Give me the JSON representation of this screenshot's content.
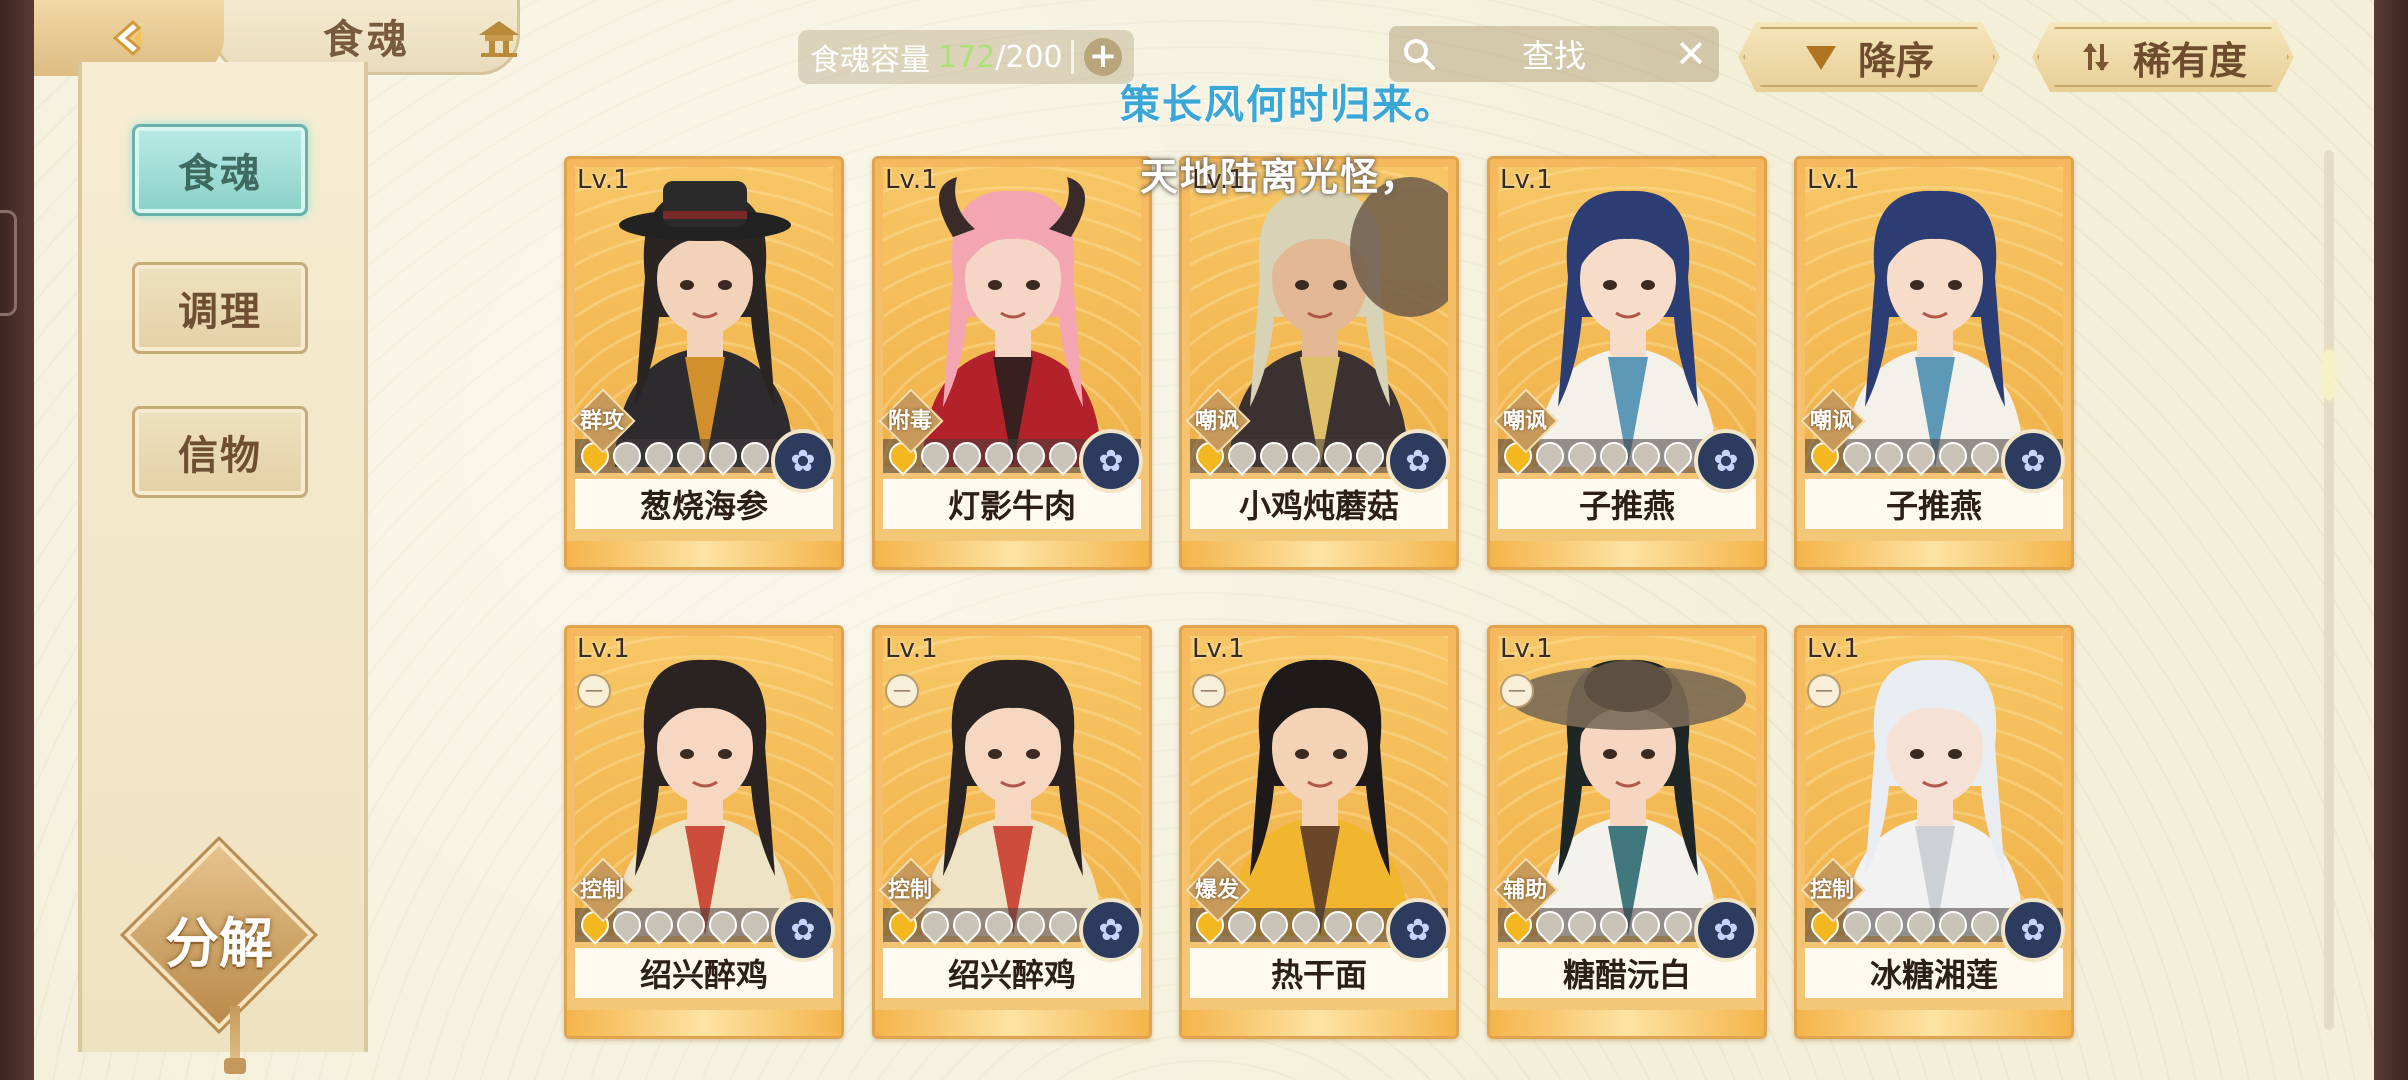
{
  "header": {
    "title": "食魂",
    "capacity_label": "食魂容量",
    "capacity_current": "172",
    "capacity_max": "/200",
    "search_placeholder": "查找",
    "sort_label": "降序",
    "rarity_label": "稀有度"
  },
  "sidebar": {
    "items": [
      {
        "label": "食魂",
        "active": true
      },
      {
        "label": "调理",
        "active": false
      },
      {
        "label": "信物",
        "active": false
      }
    ],
    "decompose_label": "分解"
  },
  "subtitles": {
    "line1": "策长风何时归来。",
    "line2": "天地陆离光怪，"
  },
  "cards": [
    {
      "level": "Lv.1",
      "role": "群攻",
      "name": "葱烧海参",
      "stars": 1,
      "locked": false
    },
    {
      "level": "Lv.1",
      "role": "附毒",
      "name": "灯影牛肉",
      "stars": 1,
      "locked": false
    },
    {
      "level": "Lv.1",
      "role": "嘲讽",
      "name": "小鸡炖蘑菇",
      "stars": 1,
      "locked": false
    },
    {
      "level": "Lv.1",
      "role": "嘲讽",
      "name": "子推燕",
      "stars": 1,
      "locked": false
    },
    {
      "level": "Lv.1",
      "role": "嘲讽",
      "name": "子推燕",
      "stars": 1,
      "locked": false
    },
    {
      "level": "Lv.1",
      "role": "控制",
      "name": "绍兴醉鸡",
      "stars": 1,
      "locked": true
    },
    {
      "level": "Lv.1",
      "role": "控制",
      "name": "绍兴醉鸡",
      "stars": 1,
      "locked": true
    },
    {
      "level": "Lv.1",
      "role": "爆发",
      "name": "热干面",
      "stars": 1,
      "locked": true
    },
    {
      "level": "Lv.1",
      "role": "辅助",
      "name": "糖醋沅白",
      "stars": 1,
      "locked": true
    },
    {
      "level": "Lv.1",
      "role": "控制",
      "name": "冰糖湘莲",
      "stars": 1,
      "locked": true
    }
  ],
  "colors": {
    "accent_teal": "#8ad0c8",
    "card_gold": "#f6b85d",
    "subtitle_blue": "#3aa7d6",
    "capacity_green": "#aee07a"
  }
}
